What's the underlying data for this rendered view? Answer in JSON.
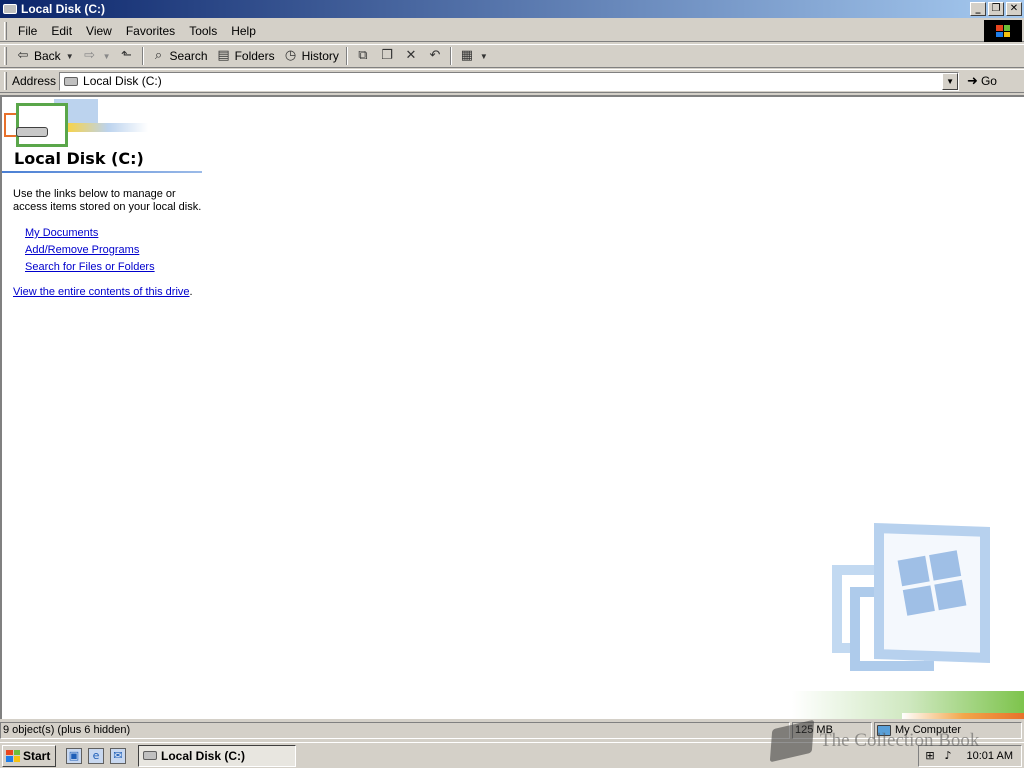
{
  "window": {
    "title": "Local Disk (C:)",
    "minimize_glyph": "_",
    "restore_glyph": "❐",
    "close_glyph": "✕"
  },
  "menu": {
    "items": [
      "File",
      "Edit",
      "View",
      "Favorites",
      "Tools",
      "Help"
    ]
  },
  "toolbar": {
    "back_label": "Back",
    "search_label": "Search",
    "folders_label": "Folders",
    "history_label": "History"
  },
  "address": {
    "label": "Address",
    "value": "Local Disk (C:)",
    "go_label": "Go"
  },
  "content": {
    "title": "Local Disk (C:)",
    "description": "Use the links below to manage or access items stored on your local disk.",
    "links": [
      "My Documents",
      "Add/Remove Programs",
      "Search for Files or Folders"
    ],
    "view_link": "View the entire contents of this drive",
    "view_suffix": "."
  },
  "statusbar": {
    "objects": "9 object(s) (plus 6 hidden)",
    "size": "125 MB",
    "zone": "My Computer"
  },
  "taskbar": {
    "start_label": "Start",
    "task_label": "Local Disk (C:)",
    "clock": "10:01 AM"
  },
  "watermark": {
    "text": "The Collection Book"
  },
  "colors": {
    "titlebar_start": "#0a246a",
    "titlebar_end": "#a6caf0",
    "link": "#0000cc",
    "chrome": "#d4d0c8"
  },
  "icons": [
    "drive-icon",
    "back-arrow-icon",
    "forward-arrow-icon",
    "up-folder-icon",
    "search-icon",
    "folders-icon",
    "history-icon",
    "move-to-icon",
    "copy-to-icon",
    "delete-icon",
    "undo-icon",
    "views-icon",
    "go-arrow-icon",
    "windows-flag-icon",
    "my-computer-icon",
    "desktop-icon",
    "ie-icon",
    "outlook-icon",
    "volume-icon",
    "network-icon"
  ]
}
